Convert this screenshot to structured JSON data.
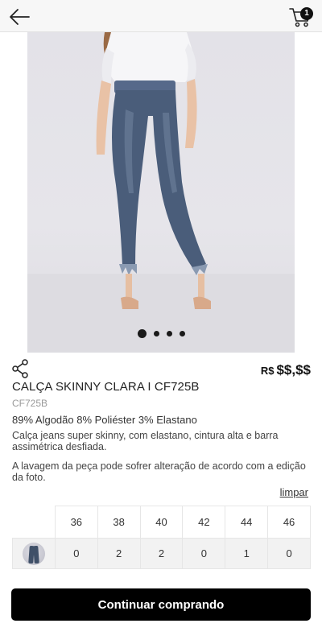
{
  "header": {
    "back_icon": "arrow-left-icon",
    "cart_icon": "shopping-cart-icon",
    "cart_count": "1"
  },
  "gallery": {
    "image_description": "model wearing light-wash skinny jeans with frayed hem and white blouse",
    "slide_count": 4,
    "active_slide": 1
  },
  "product": {
    "share_icon": "share-icon",
    "price_currency": "R$",
    "price_value": "$$,$$",
    "title": "CALÇA SKINNY CLARA I CF725B",
    "sku": "CF725B",
    "composition": "89% Algodão 8% Poliéster 3% Elastano",
    "description": "Calça jeans super skinny, com elastano, cintura alta e barra assimétrica desfiada.",
    "note": "A lavagem da peça pode sofrer alteração de acordo com a edição da foto."
  },
  "size_grid": {
    "clear_label": "limpar",
    "sizes": [
      "36",
      "38",
      "40",
      "42",
      "44",
      "46"
    ],
    "quantities": [
      "0",
      "2",
      "2",
      "0",
      "1",
      "0"
    ]
  },
  "footer": {
    "cta_label": "Continuar comprando"
  },
  "colors": {
    "primary": "#000000",
    "header_bg": "#f7f7f7",
    "denim": "#4a5d7a"
  }
}
